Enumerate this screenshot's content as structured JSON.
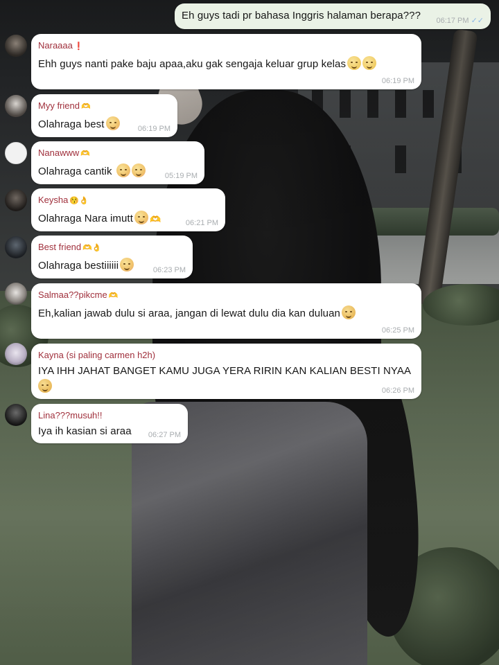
{
  "outgoing": {
    "text": "Eh guys tadi pr bahasa Inggris halaman berapa???",
    "time": "06:17 PM",
    "ticks": "✓✓"
  },
  "messages": [
    {
      "sender": "Naraaaa",
      "sender_deco": "❗",
      "text": "Ehh guys nanti pake baju apaa,aku gak sengaja keluar grup kelas",
      "time": "06:19 PM",
      "emojis": [
        "sad-face-icon",
        "sad-face-icon"
      ]
    },
    {
      "sender": "Myy friend",
      "sender_deco": "🫶",
      "text": "Olahraga best",
      "time": "06:19 PM",
      "emojis": [
        "blushing-face-icon"
      ]
    },
    {
      "sender": "Nanawww",
      "sender_deco": "🫶",
      "text": "Olahraga cantik ",
      "time": "05:19 PM",
      "emojis": [
        "blushing-face-icon",
        "blushing-face-icon"
      ]
    },
    {
      "sender": "Keysha",
      "sender_deco": "😚👌",
      "text": "Olahraga Nara imutt",
      "time": "06:21 PM",
      "emojis": [
        "blushing-face-icon",
        "heart-hands-icon"
      ]
    },
    {
      "sender": "Best friend",
      "sender_deco": "🫶👌",
      "text": "Olahraga bestiiiiii",
      "time": "06:23 PM",
      "emojis": [
        "blushing-face-icon"
      ]
    },
    {
      "sender": "Salmaa??pikcme",
      "sender_deco": "🫶",
      "text": "Eh,kalian jawab dulu si araa, jangan di lewat dulu dia kan duluan",
      "time": "06:25 PM",
      "emojis": [
        "angry-face-icon"
      ]
    },
    {
      "sender": "Kayna (si paling carmen h2h)",
      "sender_deco": "",
      "text": "IYA IHH JAHAT BANGET KAMU JUGA YERA RIRIN KAN KALIAN BESTI NYAA",
      "time": "06:26 PM",
      "emojis": [
        "angry-face-icon"
      ]
    },
    {
      "sender": "Lina???musuh!!",
      "sender_deco": "",
      "text": "Iya ih kasian si araa",
      "time": "06:27 PM",
      "emojis": []
    }
  ],
  "colors": {
    "sender_name": "#a0303c",
    "bubble": "#ffffff",
    "outgoing_bubble": "#eaf2e6",
    "timestamp": "#a9adb0",
    "read_ticks": "#8ab6e8"
  }
}
